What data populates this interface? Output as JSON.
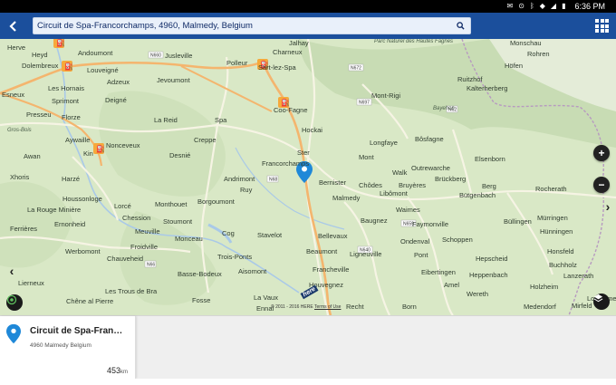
{
  "status_bar": {
    "time": "6:36 PM",
    "icons": [
      "mail-icon",
      "location-icon",
      "bluetooth-icon",
      "wifi-icon",
      "signal-icon",
      "battery-icon"
    ]
  },
  "header": {
    "search_value": "Circuit de Spa-Francorchamps, 4960, Malmedy, Belgium"
  },
  "map": {
    "places": [
      [
        "Herve",
        8,
        5
      ],
      [
        "Andoumont",
        86,
        11
      ],
      [
        "Jusleville",
        182,
        14
      ],
      [
        "Polleur",
        250,
        22
      ],
      [
        "Charneux",
        301,
        10
      ],
      [
        "Jalhay",
        319,
        0
      ],
      [
        "Heyd",
        35,
        13
      ],
      [
        "Dolembreux",
        24,
        25
      ],
      [
        "Louveigné",
        96,
        30
      ],
      [
        "Adzeux",
        118,
        43
      ],
      [
        "Jevoumont",
        173,
        41
      ],
      [
        "Sart-lez-Spa",
        285,
        27
      ],
      [
        "Les Hornais",
        53,
        50
      ],
      [
        "Sprimont",
        57,
        64
      ],
      [
        "Deigné",
        116,
        63
      ],
      [
        "La Reid",
        170,
        85
      ],
      [
        "Spa",
        237,
        85
      ],
      [
        "Coo-Fagne",
        302,
        74
      ],
      [
        "Presseu",
        29,
        79
      ],
      [
        "Florze",
        68,
        82
      ],
      [
        "Aywaille",
        72,
        107
      ],
      [
        "Nonceveux",
        117,
        113
      ],
      [
        "Creppe",
        214,
        107
      ],
      [
        "Hockai",
        333,
        96
      ],
      [
        "Awan",
        26,
        125
      ],
      [
        "Kin",
        92,
        122
      ],
      [
        "Desnié",
        187,
        124
      ],
      [
        "Ster",
        328,
        121
      ],
      [
        "Longfaye",
        408,
        110
      ],
      [
        "Bôsfagne",
        458,
        106
      ],
      [
        "Francorchamps",
        289,
        133
      ],
      [
        "Mont",
        396,
        126
      ],
      [
        "Xhoris",
        11,
        148
      ],
      [
        "Harzé",
        68,
        150
      ],
      [
        "Andrimont",
        247,
        150
      ],
      [
        "Ruy",
        265,
        162
      ],
      [
        "Bernister",
        352,
        154
      ],
      [
        "Chôdes",
        396,
        157
      ],
      [
        "Libômont",
        419,
        166
      ],
      [
        "Walk",
        433,
        143
      ],
      [
        "Outrewarche",
        454,
        138
      ],
      [
        "Brückberg",
        480,
        150
      ],
      [
        "Elsenborn",
        524,
        128
      ],
      [
        "Berg",
        532,
        158
      ],
      [
        "Bütgenbach",
        507,
        168
      ],
      [
        "Rocherath",
        591,
        161
      ],
      [
        "Houssonloge",
        69,
        172
      ],
      [
        "Lorcé",
        126,
        180
      ],
      [
        "Monthouet",
        171,
        178
      ],
      [
        "Borgoumont",
        218,
        175
      ],
      [
        "Malmedy",
        367,
        171
      ],
      [
        "Bruyères",
        440,
        157
      ],
      [
        "Waimes",
        437,
        184
      ],
      [
        "La Rouge Minière",
        30,
        184
      ],
      [
        "Chession",
        135,
        193
      ],
      [
        "Stoumont",
        180,
        197
      ],
      [
        "Ernonheid",
        60,
        200
      ],
      [
        "Baugnez",
        398,
        196
      ],
      [
        "Faymonville",
        455,
        200
      ],
      [
        "Büllingen",
        556,
        197
      ],
      [
        "Mürringen",
        593,
        193
      ],
      [
        "Ferrières",
        11,
        205
      ],
      [
        "Meuville",
        149,
        208
      ],
      [
        "Cog",
        245,
        210
      ],
      [
        "Stavelot",
        284,
        212
      ],
      [
        "Bellevaux",
        351,
        213
      ],
      [
        "Ondenval",
        442,
        219
      ],
      [
        "Schoppen",
        488,
        217
      ],
      [
        "Hünningen",
        596,
        208
      ],
      [
        "Werbomont",
        72,
        230
      ],
      [
        "Froidville",
        144,
        225
      ],
      [
        "Monceau",
        193,
        216
      ],
      [
        "Beaumont",
        338,
        230
      ],
      [
        "Ligneuville",
        386,
        233
      ],
      [
        "Hepscheid",
        525,
        238
      ],
      [
        "Honsfeld",
        604,
        230
      ],
      [
        "Chauveheid",
        118,
        238
      ],
      [
        "Trois-Ponts",
        240,
        236
      ],
      [
        "Francheville",
        345,
        250
      ],
      [
        "Eibertingen",
        465,
        253
      ],
      [
        "Heppenbach",
        518,
        256
      ],
      [
        "Buchholz",
        606,
        245
      ],
      [
        "Basse-Bodeux",
        196,
        255
      ],
      [
        "Aisomont",
        263,
        252
      ],
      [
        "Lanzerath",
        622,
        257
      ],
      [
        "Pont",
        457,
        234
      ],
      [
        "Lierneux",
        20,
        265
      ],
      [
        "Amel",
        490,
        267
      ],
      [
        "Holzheim",
        585,
        269
      ],
      [
        "Houvegnez",
        341,
        267
      ],
      [
        "Les Trous de Bra",
        116,
        274
      ],
      [
        "Fosse",
        212,
        284
      ],
      [
        "La Vaux",
        280,
        281
      ],
      [
        "Wereth",
        515,
        277
      ],
      [
        "Chêne al Pierre",
        73,
        285
      ],
      [
        "Born",
        444,
        291
      ],
      [
        "Recht",
        382,
        291
      ],
      [
        "Medendorf",
        578,
        291
      ],
      [
        "Ennal",
        283,
        293
      ],
      [
        "Mirfeld",
        631,
        290
      ],
      [
        "Losheimergraben",
        648,
        282
      ],
      [
        "Ruitzhof",
        505,
        40
      ],
      [
        "Höfen",
        557,
        25
      ],
      [
        "Kalterherberg",
        515,
        50
      ],
      [
        "Rohren",
        582,
        12
      ],
      [
        "Monschau",
        563,
        0
      ],
      [
        "Mont-Rigi",
        410,
        58
      ],
      [
        "Esneux",
        2,
        57
      ]
    ],
    "small_places": [
      [
        "Parc Naturel des Hautes Fagnes",
        413,
        0
      ],
      [
        "Bayehon",
        478,
        74
      ],
      [
        "Gros-Bois",
        8,
        98
      ]
    ],
    "road_labels": [
      "N697",
      "N62",
      "N68",
      "N66",
      "N640",
      "N659",
      "N672",
      "N660"
    ],
    "copyright": "© 2011 - 2016 HERE",
    "terms": "Terms of Use",
    "here_logo": "here"
  },
  "info_card": {
    "name": "Circuit de Spa-Fran…",
    "address": "4960 Malmedy Belgium",
    "distance": "453",
    "distance_unit": "km"
  },
  "colors": {
    "header": "#1b4f9c",
    "pin": "#1f88d8",
    "road": "#f2f0de",
    "highway": "#f4b56e",
    "water": "#a9c9e8"
  }
}
